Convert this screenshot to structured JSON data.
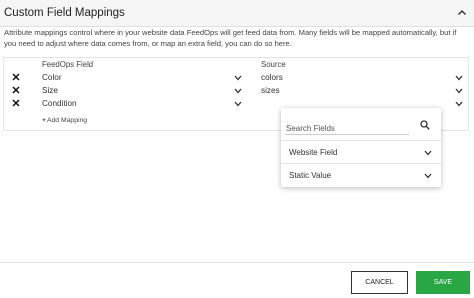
{
  "header": {
    "title": "Custom Field Mappings",
    "toggle_icon": "chevron-up-icon"
  },
  "description": "Attribute mappings control where in your website data FeedOps will get feed data from. Many fields will be mapped automatically, but if you need to adjust where data comes from, or map an extra field, you can do so here.",
  "mappings": {
    "column_feedops": "FeedOps Field",
    "column_source": "Source",
    "rows": [
      {
        "field": "Color",
        "source": "colors"
      },
      {
        "field": "Size",
        "source": "sizes"
      },
      {
        "field": "Condition",
        "source": ""
      }
    ],
    "remove_icon": "close-icon",
    "add_label": "Add Mapping",
    "add_icon": "plus-icon"
  },
  "source_dropdown": {
    "search_placeholder": "Search Fields",
    "search_icon": "search-icon",
    "options": [
      "Website Field",
      "Static Value"
    ]
  },
  "footer": {
    "cancel_label": "CANCEL",
    "save_label": "SAVE"
  },
  "colors": {
    "save_button": "#2aa745",
    "header_bg": "#f5f5f5"
  }
}
